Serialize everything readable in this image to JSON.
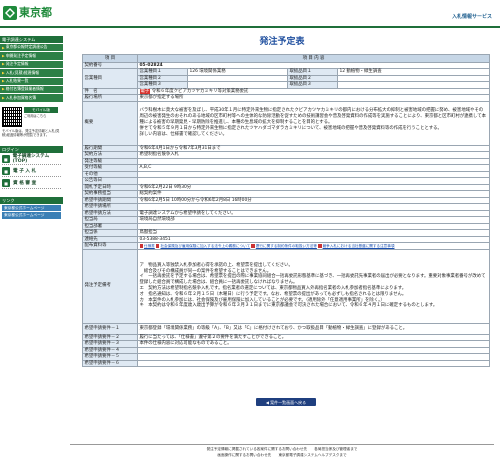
{
  "header": {
    "logo_text": "東京都",
    "right_link": "入札情報サービス"
  },
  "sidebar": {
    "section_title": "電子調達システム",
    "menu": [
      "東京都公報特定調達公告",
      "申開発注予定情報",
      "発注予定情報",
      "入札(見積)経過情報",
      "入札結果一覧",
      "格付名簿登録業者情報",
      "入札参加資格名簿"
    ],
    "mobile_badge_title": "モバイル版",
    "mobile_badge_text": "ご利用はこちら",
    "mobile_note": "モバイル版は、発注予定情報と入札(見積)経過情報等が閲覧できます。",
    "section2_title": "ログイン",
    "big_links": [
      "電子調達システム(TOP)",
      "電 子 入 札",
      "資 格 審 査"
    ],
    "section3_title": "リンク",
    "sub_links": [
      "東京都公式ホームページ",
      "東京都公式ホームページ"
    ]
  },
  "main": {
    "page_title": "発注予定表",
    "table_headers": [
      "項 目",
      "項 目 内 容"
    ],
    "rows": {
      "contract_no_label": "契約番号",
      "contract_no": "05-02824",
      "business_category_label": "営業種目",
      "business_items": [
        "営業種目１",
        "営業種目２",
        "営業種目３"
      ],
      "business_values": [
        "126 環境関係業務",
        "",
        ""
      ],
      "sub_items": [
        "取扱品目１",
        "取扱品目２",
        "取扱品目３"
      ],
      "sub_values": [
        "12 動植物・緑生調査",
        "",
        ""
      ],
      "name_label": "件　名",
      "name_tag": "電子",
      "name_value": "令和６年度クビアカツヤカミキリ等対策業務委託",
      "location_label": "履行場所",
      "location_value": "東京都が指定する場所",
      "overview_label": "概要",
      "overview_value": "バラ科樹木に莫大な被害を及ぼし、平成30年１月に特定外来生物に指定されたクビアカツヤカミキリの都内における分布拡大の抑制と被害地域の把握に努め、被害地域やその周辺の被害発生のおそれのある地域の区市町村等への主体的な防除活動を促すための技術講習会や普及啓発資料の作成等を実施することにより、東京都と区市町村が連携して本種による被害の早期発見・早期防除を推進し、本種の生息域の拡大を抑制することを目的とする。\n併せて令和５年９月１日から特定外来生物に指定されたツヤハダゴマダラカミキリについて、被害地域の把握や普及啓発資料等の作成を行うこととする。\n詳しい内容は、仕様書で確認してください。",
      "period_label": "履行期間",
      "period_value": "令和6年4月1日から令和7年3月31日まで",
      "method_label": "契約方法",
      "method_value": "希望制指名競争入札",
      "dept_label": "発注等級",
      "dept_value": "",
      "grade_label": "受付等級",
      "grade_value": "A,B,C",
      "other_label": "その他",
      "other_value": "",
      "public_date_label": "公告等日",
      "public_date_value": "",
      "open_label": "開札予定日時",
      "open_value": "令和6年2月22日 9時30分",
      "contract_type_label": "契約事務担当",
      "contract_type_value": "総契約案件",
      "apply_period_label": "希望申請期間",
      "apply_period_value": "令和6年2月5日 10時00分から令和6年2月8日 16時00分",
      "apply_place_label": "希望申請場所",
      "apply_place_value": "",
      "apply_method_label": "希望申請方法",
      "apply_method_value": "電子調達システムから希望申請をしてください。",
      "bureau_label": "担当局",
      "bureau_value": "環境局自然環境部",
      "section_label": "担当部署",
      "section_value": "",
      "person_label": "担当係",
      "person_value": "鳥獣担当",
      "phone_label": "連絡先",
      "phone_value": "03-5388-3451",
      "docs_label": "配布資料等",
      "docs_links": [
        "仕様書",
        "社会保険及び雇用保険に加入する法令上の義務について",
        "履行に関する制約条件の取扱い方法等",
        "競争入札における当社基盤に関する注意事項"
      ],
      "remarks_label": "発注予定備考",
      "remarks_value": "ア　物品買入等独禁入札参加者心得を承諾の上、希望票を提出してください。\n　総合及びその構成員が同一の案件を希望することはできません。\nイ　一括再委託を予定する場合は、希望票を提出の際に事業協同組合一括再委託形態基準に基づき、一括再委託先事業者の届出が必要となります。重要対象事業者番号が改めて登録した組合員で構成した場合は、組合員に一括再委託しなければなりません。\nエ　契約方法は希望制指名競争入札です。指名業者の選定については、東京都物品買入外再指名業者の入札参加者指名基準によります。\nオ　指名通知は、令和６年２月１５日（木曜日）に行う予定です。なお、希望票の提出があっても必ずしも指名されるとは限りません。\nカ　本案件の入札参加には、社会保険及び雇用保険に加入していることが必要です。（適用除外「任意適用事業所」を除く。）\nキ　本契約は令和６年度歳入歳出予算が令和６年３月３１日までに東京都議会で可決された場合において、令和６年４月１日に確定するものとします。",
      "cond1_label": "希望申請要件－１",
      "cond1_value": "東京都登録「環境関係業務」の等級「A」、「B」又は「C」に格付けされており、かつ取扱品目「動植物・緑生調査」に登録があること。",
      "cond2_label": "希望申請要件－２",
      "cond2_value": "履行に当たっては、「仕様書」遵守第２の要件を満たすことができること。",
      "cond3_label": "希望申請要件－３",
      "cond3_value": "本件の仕様内容に対応可能なものであること。",
      "cond4_label": "希望申請要件－４",
      "cond5_label": "希望申請要件－５",
      "cond6_label": "希望申請要件－６"
    },
    "back_button": "◀ 案件一覧画面へ戻る",
    "footer_line1": "発注予定情報に掲載されている各案件に関するお問い合わせ先　　各局担当係及び管理者まで",
    "footer_line2": "画面操作に関するお問い合わせ先　　東京都電子調達システムヘルプデスクまで"
  }
}
